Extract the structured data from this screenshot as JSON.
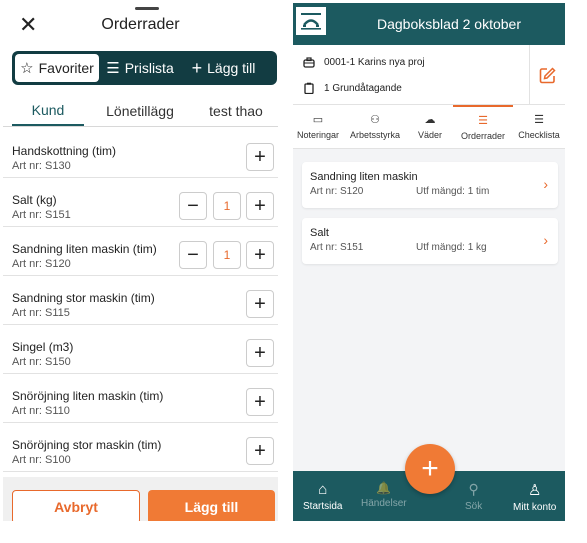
{
  "left": {
    "title": "Orderrader",
    "close_glyph": "✕",
    "segments": [
      {
        "icon": "☆",
        "label": "Favoriter",
        "active": true
      },
      {
        "icon": "☰",
        "label": "Prislista",
        "active": false
      },
      {
        "icon": "+",
        "label": "Lägg till",
        "active": false
      }
    ],
    "tabs": [
      "Kund",
      "Lönetillägg",
      "test thao"
    ],
    "items": [
      {
        "name": "Handskottning (tim)",
        "art": "Art nr: S130"
      },
      {
        "name": "Salt (kg)",
        "art": "Art nr: S151",
        "qty": "1"
      },
      {
        "name": "Sandning liten maskin (tim)",
        "art": "Art nr: S120",
        "qty": "1"
      },
      {
        "name": "Sandning stor maskin (tim)",
        "art": "Art nr: S115"
      },
      {
        "name": "Singel (m3)",
        "art": "Art nr: S150"
      },
      {
        "name": "Snöröjning liten maskin (tim)",
        "art": "Art nr: S110"
      },
      {
        "name": "Snöröjning stor maskin (tim)",
        "art": "Art nr: S100"
      }
    ],
    "cancel_label": "Avbryt",
    "add_label": "Lägg till"
  },
  "right": {
    "title": "Dagboksblad 2 oktober",
    "project": "0001-1 Karins nya proj",
    "task": "1 Grundåtagande",
    "tabs": [
      {
        "icon": "▭",
        "label": "Noteringar"
      },
      {
        "icon": "⚇",
        "label": "Arbetsstyrka"
      },
      {
        "icon": "☁",
        "label": "Väder"
      },
      {
        "icon": "☰",
        "label": "Orderrader",
        "active": true
      },
      {
        "icon": "☰",
        "label": "Checklista"
      }
    ],
    "orders": [
      {
        "name": "Sandning liten maskin",
        "art": "Art nr: S120",
        "amount": "Utf mängd: 1 tim"
      },
      {
        "name": "Salt",
        "art": "Art nr: S151",
        "amount": "Utf mängd: 1 kg"
      }
    ],
    "nav": [
      {
        "icon": "⌂",
        "label": "Startsida"
      },
      {
        "icon": "🔔",
        "label": "Händelser"
      },
      {
        "icon": "⚲",
        "label": "Sök"
      },
      {
        "icon": "♙",
        "label": "Mitt konto"
      }
    ],
    "fab_glyph": "+"
  },
  "colors": {
    "brand": "#1c5a60",
    "accent": "#f07a35",
    "seg_bg": "#123c42"
  }
}
